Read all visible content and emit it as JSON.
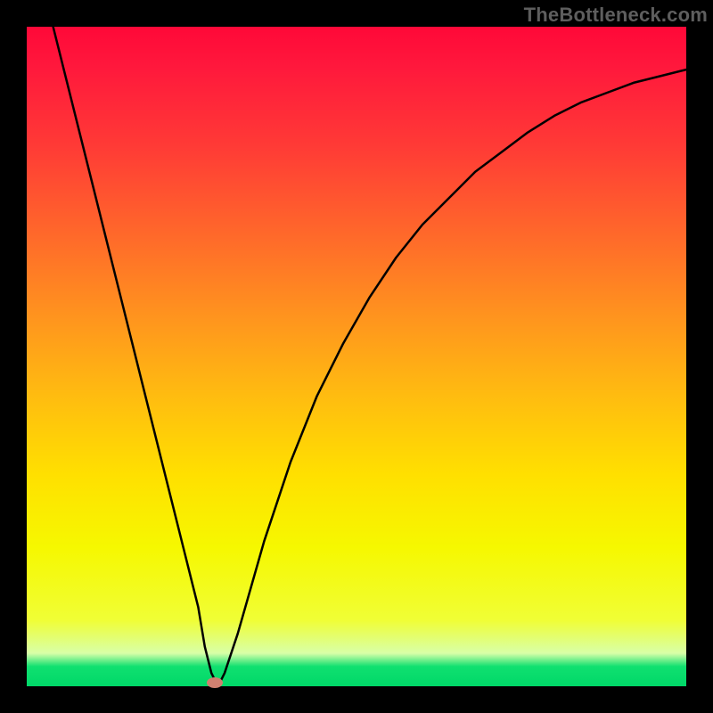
{
  "watermark": "TheBottleneck.com",
  "colors": {
    "frame": "#000000",
    "curve": "#000000",
    "marker": "#d08070",
    "gradient": [
      "#ff0838",
      "#ff183c",
      "#ff3a36",
      "#ff6a2a",
      "#ff941e",
      "#ffbc10",
      "#ffe000",
      "#f6f800",
      "#f0fe36",
      "#d8ffa8",
      "#10e070",
      "#00d868"
    ]
  },
  "chart_data": {
    "type": "line",
    "title": "",
    "xlabel": "",
    "ylabel": "",
    "xlim": [
      0,
      100
    ],
    "ylim": [
      0,
      100
    ],
    "x": [
      0,
      2,
      4,
      6,
      8,
      10,
      12,
      14,
      16,
      18,
      20,
      22,
      24,
      26,
      27,
      28,
      29,
      30,
      32,
      34,
      36,
      38,
      40,
      44,
      48,
      52,
      56,
      60,
      64,
      68,
      72,
      76,
      80,
      84,
      88,
      92,
      96,
      100
    ],
    "values": [
      116,
      108,
      100,
      92,
      84,
      76,
      68,
      60,
      52,
      44,
      36,
      28,
      20,
      12,
      6,
      2,
      0,
      2,
      8,
      15,
      22,
      28,
      34,
      44,
      52,
      59,
      65,
      70,
      74,
      78,
      81,
      84,
      86.5,
      88.5,
      90,
      91.5,
      92.5,
      93.5
    ],
    "marker": {
      "x": 28.5,
      "y": 0.5
    },
    "annotations": []
  }
}
